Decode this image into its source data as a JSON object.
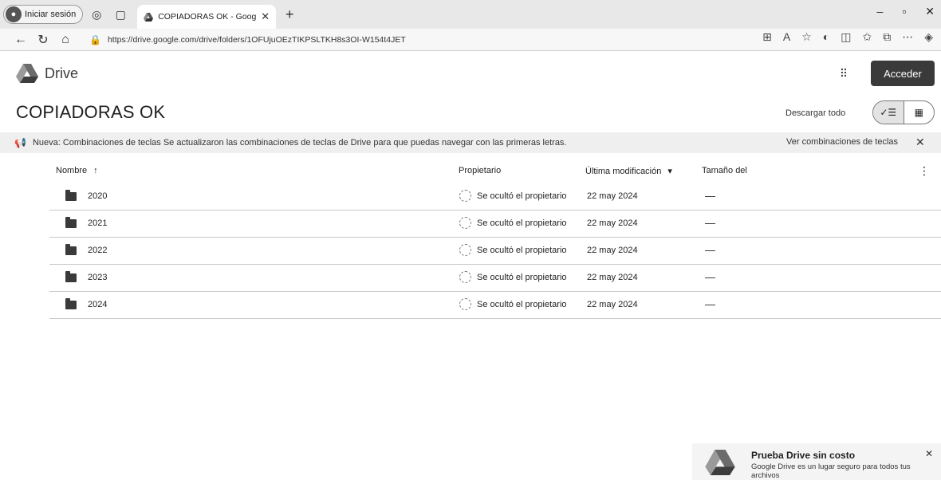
{
  "browser": {
    "profile_label": "Iniciar sesión",
    "tab_title": "COPIADORAS OK - Google Drive",
    "url": "https://drive.google.com/drive/folders/1OFUjuOEzTIKPSLTKH8s3OI-W154t4JET"
  },
  "header": {
    "app_name": "Drive",
    "signin_label": "Acceder"
  },
  "folder": {
    "title": "COPIADORAS OK",
    "download_all_label": "Descargar todo"
  },
  "banner": {
    "text": "Nueva: Combinaciones de teclas Se actualizaron las combinaciones de teclas de Drive para que puedas navegar con las primeras letras.",
    "link_label": "Ver combinaciones de teclas"
  },
  "table": {
    "columns": {
      "name": "Nombre",
      "owner": "Propietario",
      "modified": "Última modificación",
      "size": "Tamaño del"
    },
    "rows": [
      {
        "name": "2020",
        "owner": "Se ocultó el propietario",
        "modified": "22 may 2024",
        "size": "—"
      },
      {
        "name": "2021",
        "owner": "Se ocultó el propietario",
        "modified": "22 may 2024",
        "size": "—"
      },
      {
        "name": "2022",
        "owner": "Se ocultó el propietario",
        "modified": "22 may 2024",
        "size": "—"
      },
      {
        "name": "2023",
        "owner": "Se ocultó el propietario",
        "modified": "22 may 2024",
        "size": "—"
      },
      {
        "name": "2024",
        "owner": "Se ocultó el propietario",
        "modified": "22 may 2024",
        "size": "—"
      }
    ]
  },
  "promo": {
    "title": "Prueba Drive sin costo",
    "body": "Google Drive es un lugar seguro para todos tus archivos"
  },
  "icons": {
    "sort_direction": "arrow-up-icon",
    "modified_sort": "caret-down-icon"
  }
}
